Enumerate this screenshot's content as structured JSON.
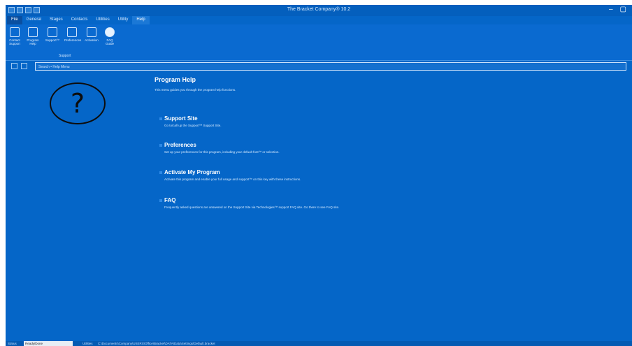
{
  "window": {
    "title": "The Bracket Company® 10.2",
    "controls": [
      "–",
      "▢"
    ]
  },
  "ribbon": {
    "tabs": [
      "File",
      "General",
      "Stages",
      "Contacts",
      "Utilities",
      "Utility",
      "Help"
    ],
    "active_tab": "Help",
    "buttons": [
      {
        "label": "Contact Support",
        "icon": "contact-support-icon"
      },
      {
        "label": "Program Help",
        "icon": "program-help-icon"
      },
      {
        "label": "Support™",
        "icon": "support-icon"
      },
      {
        "label": "Preferences",
        "icon": "preferences-icon"
      },
      {
        "label": "Activation",
        "icon": "activation-icon"
      },
      {
        "label": "FAQ Guide",
        "icon": "faq-icon"
      }
    ],
    "group_label": "Support"
  },
  "search": {
    "text": "Search • Help Menu"
  },
  "content": {
    "title": "Program Help",
    "subtitle": "This menu guides you through the program help functions.",
    "items": [
      {
        "title": "Support Site",
        "desc": "Go to/call up the Support™ Support Site."
      },
      {
        "title": "Preferences",
        "desc": "Set up your preferences for this program, including your default font™ or selection."
      },
      {
        "title": "Activate My Program",
        "desc": "Activate this program and enable your full usage and support™ on this key with these instructions."
      },
      {
        "title": "FAQ",
        "desc": "Frequently asked questions are answered on the Support Site via Technologies™ support FAQ site. Go there to see FAQ site."
      }
    ]
  },
  "status": {
    "label": "Status",
    "value": "Ready/Done",
    "label2": "Utilities",
    "path": "C:\\Documents\\Company\\USERS\\Office\\Bracket\\DATA\\Data\\Settings\\Default.bracket"
  }
}
